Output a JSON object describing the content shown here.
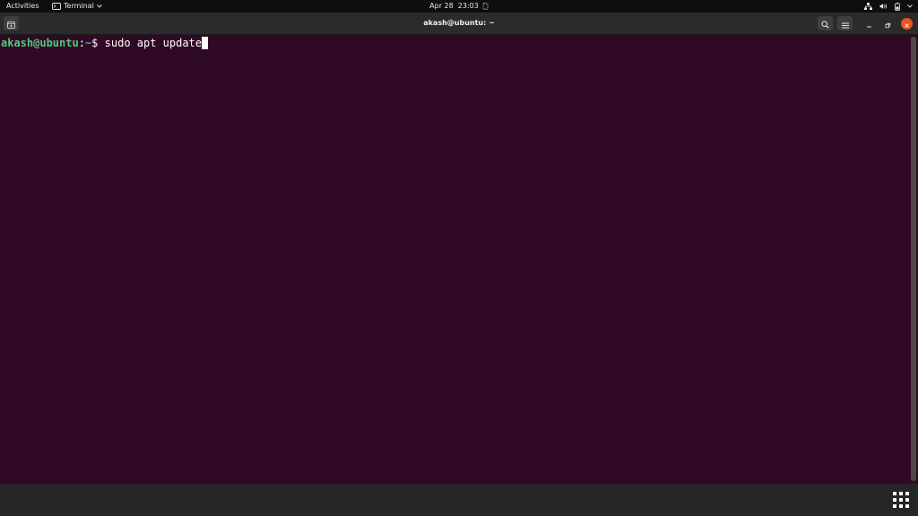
{
  "topbar": {
    "activities": "Activities",
    "app_name": "Terminal",
    "clock": "Apr 28  23:03",
    "icons": [
      "terminal-icon",
      "chevron-down-icon",
      "notification-icon",
      "network-icon",
      "volume-icon",
      "battery-icon",
      "chevron-down-icon"
    ]
  },
  "window": {
    "title": "akash@ubuntu: ~",
    "icons": [
      "new-tab-icon",
      "search-icon",
      "hamburger-menu-icon",
      "minimize-icon",
      "restore-icon",
      "close-icon"
    ]
  },
  "terminal": {
    "user_host": "akash@ubuntu",
    "separator": ":",
    "path": "~",
    "prompt": "$",
    "command": "sudo apt update"
  },
  "dock": {
    "icons": [
      "show-applications-icon"
    ]
  },
  "colors": {
    "terminal_bg": "#300a24",
    "prompt_user": "#4fc97d",
    "prompt_path": "#6f8fd4",
    "close_button": "#e95420"
  }
}
